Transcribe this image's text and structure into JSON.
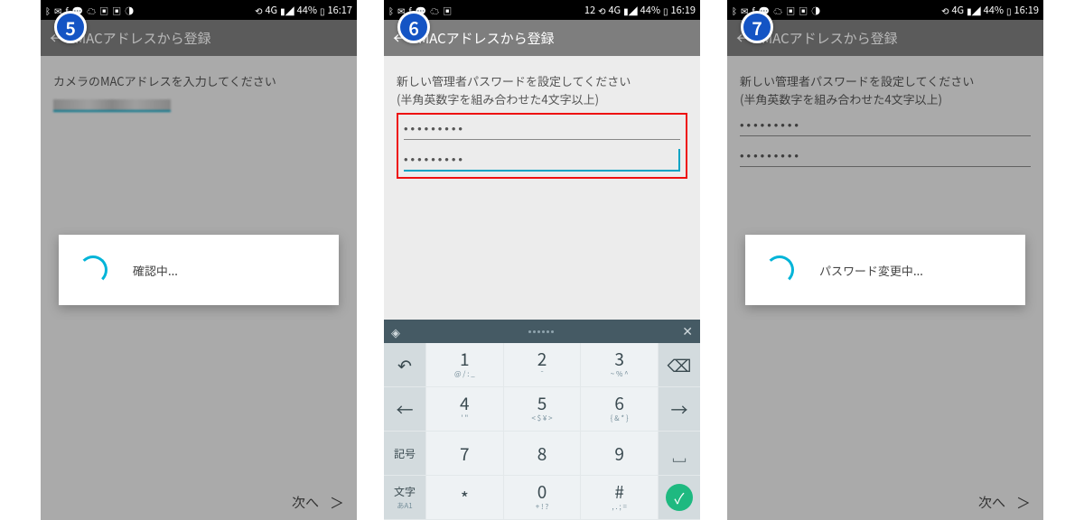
{
  "badges": {
    "b5": "5",
    "b6": "6",
    "b7": "7"
  },
  "status": {
    "battery": "44%",
    "time5": "16:17",
    "time6": "16:19",
    "time7": "16:19",
    "temp": "12",
    "net": "4G"
  },
  "header": {
    "title": "MACアドレスから登録"
  },
  "screen5": {
    "prompt": "カメラのMACアドレスを入力してください",
    "modal": "確認中...",
    "next": "次へ"
  },
  "screen6": {
    "prompt1": "新しい管理者パスワードを設定してください",
    "prompt2": "(半角英数字を組み合わせた4文字以上)",
    "pw1": "•••••••••",
    "pw2": "•••••••••"
  },
  "screen7": {
    "prompt1": "新しい管理者パスワードを設定してください",
    "prompt2": "(半角英数字を組み合わせた4文字以上)",
    "pw1": "•••••••••",
    "pw2": "•••••••••",
    "modal": "パスワード変更中...",
    "next": "次へ"
  },
  "keyboard": {
    "close": "✕",
    "rows": {
      "r1": {
        "side_l": "↶",
        "k1": {
          "m": "1",
          "s": "@ / : _"
        },
        "k2": {
          "m": "2",
          "s": "¯"
        },
        "k3": {
          "m": "3",
          "s": "~ % ^"
        },
        "side_r": "⌫"
      },
      "r2": {
        "side_l": "←",
        "k1": {
          "m": "4",
          "s": "' \""
        },
        "k2": {
          "m": "5",
          "s": "< $ ¥ >"
        },
        "k3": {
          "m": "6",
          "s": "{ & * }"
        },
        "side_r": "→"
      },
      "r3": {
        "side_l": "記号",
        "k1": {
          "m": "7",
          "s": ""
        },
        "k2": {
          "m": "8",
          "s": ""
        },
        "k3": {
          "m": "9",
          "s": ""
        },
        "side_r": "␣"
      },
      "r4": {
        "side_l": "文字",
        "side_l2": "あA1",
        "k1": {
          "m": "*",
          "s": ""
        },
        "k2": {
          "m": "0",
          "s": "+ ! ?"
        },
        "k3": {
          "m": "#",
          "s": ", . ; ="
        },
        "side_r": "✓"
      }
    }
  }
}
